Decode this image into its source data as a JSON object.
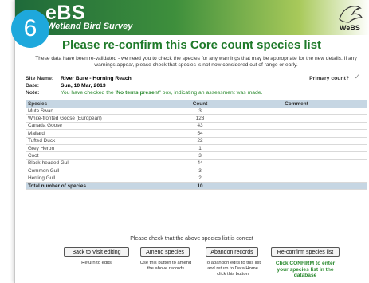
{
  "step_badge": "6",
  "header": {
    "logo_main": "eBS",
    "logo_sub": "Wetland Bird Survey",
    "corner_logo": "WeBS"
  },
  "page_title": "Please re-confirm this Core count species list",
  "intro_text": "These data have been re-validated - we need you to check the species for any warnings that may be appropriate for the new details. If any warnings appear, please check that species is not now considered out of range or early.",
  "site": {
    "name_label": "Site Name:",
    "name_value": "River Bure - Horning Reach",
    "date_label": "Date:",
    "date_value": "Sun, 10 Mar, 2013",
    "note_label": "Note:",
    "note_prefix": "You have checked the ",
    "note_bold": "'No terns present'",
    "note_suffix": " box, indicating an assessment was made.",
    "primary_label": "Primary count?",
    "primary_icon": "checkmark-icon"
  },
  "species_table": {
    "headers": [
      "Species",
      "Count",
      "Comment"
    ],
    "rows": [
      {
        "species": "Mute Swan",
        "count": "3",
        "comment": ""
      },
      {
        "species": "White-fronted Goose (European)",
        "count": "123",
        "comment": ""
      },
      {
        "species": "Canada Goose",
        "count": "43",
        "comment": ""
      },
      {
        "species": "Mallard",
        "count": "54",
        "comment": ""
      },
      {
        "species": "Tufted Duck",
        "count": "22",
        "comment": ""
      },
      {
        "species": "Grey Heron",
        "count": "1",
        "comment": ""
      },
      {
        "species": "Coot",
        "count": "3",
        "comment": ""
      },
      {
        "species": "Black-headed Gull",
        "count": "44",
        "comment": ""
      },
      {
        "species": "Common Gull",
        "count": "3",
        "comment": ""
      },
      {
        "species": "Herring Gull",
        "count": "2",
        "comment": ""
      }
    ],
    "total_label": "Total number of species",
    "total_value": "10"
  },
  "confirm_prompt": "Please check that the above species list is correct",
  "buttons": {
    "back": "Back to Visit editing",
    "amend": "Amend species",
    "abandon": "Abandon records",
    "reconfirm": "Re-confirm species list"
  },
  "help": {
    "back": "Return to edits",
    "amend_l1": "Use this button to amend",
    "amend_l2": "the above records",
    "abandon_l1": "To abandon edits to this list",
    "abandon_l2": "and return to Data Home",
    "abandon_l3": "click this button",
    "reconfirm_l1": "Click CONFIRM to enter",
    "reconfirm_l2": "your species list in the",
    "reconfirm_l3": "database"
  },
  "colors": {
    "badge": "#1ea8dc",
    "title_green": "#1f7a2a",
    "table_header": "#c6d6e3"
  }
}
